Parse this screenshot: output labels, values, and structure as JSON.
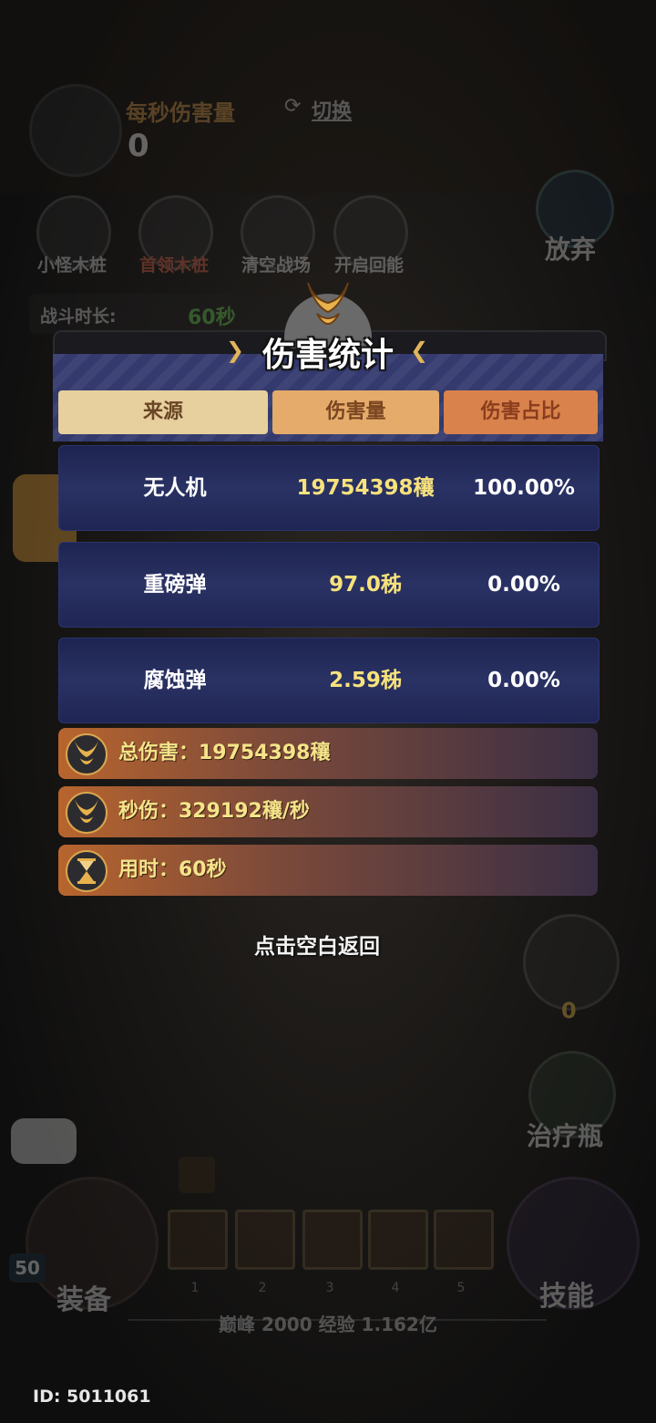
{
  "background": {
    "top_title": "每秒伤害量",
    "switch_label": "切换",
    "dps_value": "0",
    "buttons": [
      {
        "label": "小怪木桩",
        "color": "#e0e0e0"
      },
      {
        "label": "首领木桩",
        "color": "#e4684e"
      },
      {
        "label": "清空战场",
        "color": "#e0e0e0"
      },
      {
        "label": "开启回能",
        "color": "#e0e0e0"
      }
    ],
    "abandon_label": "放弃",
    "duration_label": "战斗时长:",
    "duration_value": "60秒",
    "right_counter": "0",
    "potion_label": "治疗瓶",
    "hero_level": "50",
    "equip_label": "装备",
    "skill_label": "技能",
    "slot_numbers": [
      "1",
      "2",
      "3",
      "4",
      "5"
    ],
    "exp_text": "巅峰 2000   经验 1.162亿"
  },
  "player_id": "ID: 5011061",
  "panel": {
    "title": "伤害统计",
    "headers": {
      "source": "来源",
      "damage": "伤害量",
      "percent": "伤害占比"
    },
    "rows": [
      {
        "name": "无人机",
        "damage": "19754398穰",
        "percent": "100.00%"
      },
      {
        "name": "重磅弹",
        "damage": "97.0秭",
        "percent": "0.00%"
      },
      {
        "name": "腐蚀弹",
        "damage": "2.59秭",
        "percent": "0.00%"
      }
    ],
    "summary": {
      "total": "总伤害：19754398穰",
      "dps": "秒伤：329192穰/秒",
      "time": "用时：60秒"
    },
    "return_hint": "点击空白返回"
  },
  "colors": {
    "panel_blue": "#343a6e",
    "damage_gold": "#f7e27c",
    "header_source": "#e7cf9e",
    "header_damage": "#e4ab6b",
    "header_percent": "#d9824c"
  }
}
